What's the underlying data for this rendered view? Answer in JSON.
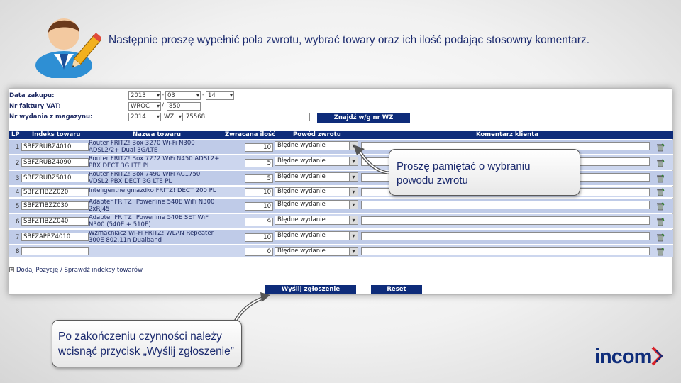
{
  "slide": {
    "title": "Następnie proszę wypełnić pola zwrotu, wybrać towary oraz ich ilość podając stosowny komentarz."
  },
  "form": {
    "purchase_date_label": "Data zakupu:",
    "purchase_year": "2013",
    "purchase_month": "03",
    "purchase_day": "14",
    "invoice_label": "Nr faktury VAT:",
    "invoice_prefix": "WROC",
    "invoice_number": "850",
    "warehouse_label": "Nr wydania z magazynu:",
    "warehouse_year": "2014",
    "warehouse_type": "WZ",
    "warehouse_number": "75568",
    "find_button": "Znajdź w/g nr WZ"
  },
  "table": {
    "headers": {
      "lp": "LP",
      "code": "Indeks towaru",
      "name": "Nazwa towaru",
      "qty": "Zwracana ilość",
      "reason": "Powód zwrotu",
      "comment": "Komentarz klienta"
    },
    "rows": [
      {
        "lp": "1",
        "code": "SBFZRUBZ4010",
        "name1": "Router FRITZ! Box 3270 Wi-Fi N300",
        "name2": "ADSL2/2+ Dual 3G/LTE",
        "qty": "10",
        "reason": "Błędne wydanie"
      },
      {
        "lp": "2",
        "code": "SBFZRUBZ4090",
        "name1": "Router FRITZ! Box 7272 WiFi N450 ADSL2+",
        "name2": "PBX DECT 3G LTE PL",
        "qty": "5",
        "reason": "Błędne wydanie"
      },
      {
        "lp": "3",
        "code": "SBFZRUBZ5010",
        "name1": "Router FRITZ! Box 7490 WiFi AC1750",
        "name2": "VDSL2 PBX DECT 3G LTE PL",
        "qty": "5",
        "reason": "Błędne wydanie"
      },
      {
        "lp": "4",
        "code": "SBFZTIBZZ020",
        "name1": "Inteligentne gniazdko FRITZ! DECT 200 PL",
        "name2": "",
        "qty": "10",
        "reason": "Błędne wydanie"
      },
      {
        "lp": "5",
        "code": "SBFZTIBZZ030",
        "name1": "Adapter FRITZ! Powerline 540E WiFi N300",
        "name2": "2xRJ45",
        "qty": "10",
        "reason": "Błędne wydanie"
      },
      {
        "lp": "6",
        "code": "SBFZTIBZZ040",
        "name1": "Adapter FRITZ! Powerline 540E SET WiFi",
        "name2": "N300 (540E + 510E)",
        "qty": "9",
        "reason": "Błędne wydanie"
      },
      {
        "lp": "7",
        "code": "SBFZAPBZ4010",
        "name1": "Wzmacniacz Wi-Fi FRITZ! WLAN Repeater",
        "name2": "300E 802.11n Dualband",
        "qty": "10",
        "reason": "Błędne wydanie"
      },
      {
        "lp": "8",
        "code": "",
        "name1": "",
        "name2": "",
        "qty": "0",
        "reason": "Błędne wydanie"
      }
    ]
  },
  "add_row_link": "Dodaj Pozycję / Sprawdź indeksy towarów",
  "buttons": {
    "submit": "Wyślij zgłoszenie",
    "reset": "Reset"
  },
  "callouts": {
    "reason_line1": "Proszę pamiętać o wybraniu",
    "reason_line2": "powodu zwrotu",
    "submit_line1": "Po zakończeniu czynności należy",
    "submit_line2": "wcisnąć przycisk „Wyślij zgłoszenie”"
  },
  "logo": "incom",
  "icons": {
    "avatar": "user-with-pencil-icon",
    "row_action": "row-delete-icon",
    "add": "plus-icon"
  },
  "colors": {
    "header_navy": "#0e2c7a",
    "row_blue": "#bfcbe8",
    "logo_red": "#d8232a"
  }
}
